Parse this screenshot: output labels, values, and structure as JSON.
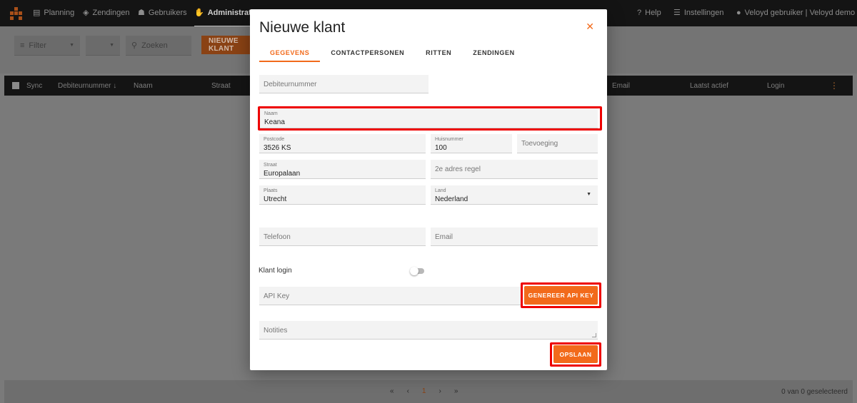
{
  "nav": {
    "items": [
      {
        "label": "Planning",
        "icon": "calendar-icon"
      },
      {
        "label": "Zendingen",
        "icon": "box-icon"
      },
      {
        "label": "Gebruikers",
        "icon": "users-icon"
      },
      {
        "label": "Administratie",
        "icon": "hand-coins-icon"
      }
    ],
    "right": {
      "help": "Help",
      "settings": "Instellingen",
      "user": "Veloyd gebruiker | Veloyd demo"
    }
  },
  "toolbar": {
    "filter_label": "Filter",
    "filter2_value": "",
    "search_placeholder": "Zoeken",
    "new_button": "NIEUWE KLANT"
  },
  "table": {
    "headers": [
      "Sync",
      "Debiteurnummer ↓",
      "Naam",
      "Straat",
      "Email",
      "Laatst actief",
      "Login"
    ]
  },
  "footer": {
    "pager": [
      "«",
      "‹",
      "1",
      "›",
      "»"
    ],
    "selected": "0 van 0 geselecteerd"
  },
  "modal": {
    "title": "Nieuwe klant",
    "close": "✕",
    "tabs": [
      "GEGEVENS",
      "CONTACTPERSONEN",
      "RITTEN",
      "ZENDINGEN"
    ],
    "fields": {
      "debiteurnummer": {
        "placeholder": "Debiteurnummer"
      },
      "naam": {
        "label": "Naam",
        "value": "Keana"
      },
      "postcode": {
        "label": "Postcode",
        "value": "3526 KS"
      },
      "huisnummer": {
        "label": "Huisnummer",
        "value": "100"
      },
      "toevoeging": {
        "placeholder": "Toevoeging"
      },
      "straat": {
        "label": "Straat",
        "value": "Europalaan"
      },
      "adres2": {
        "placeholder": "2e adres regel"
      },
      "plaats": {
        "label": "Plaats",
        "value": "Utrecht"
      },
      "land": {
        "label": "Land",
        "value": "Nederland"
      },
      "telefoon": {
        "placeholder": "Telefoon"
      },
      "email": {
        "placeholder": "Email"
      },
      "apikey": {
        "placeholder": "API Key"
      },
      "notities": {
        "placeholder": "Notities"
      }
    },
    "klant_login_label": "Klant login",
    "klant_login_enabled": false,
    "generate_api_button": "GENEREER API KEY",
    "save_button": "OPSLAAN"
  },
  "colors": {
    "accent": "#f26a1b",
    "highlight": "#e00000",
    "topbar": "#141414"
  }
}
